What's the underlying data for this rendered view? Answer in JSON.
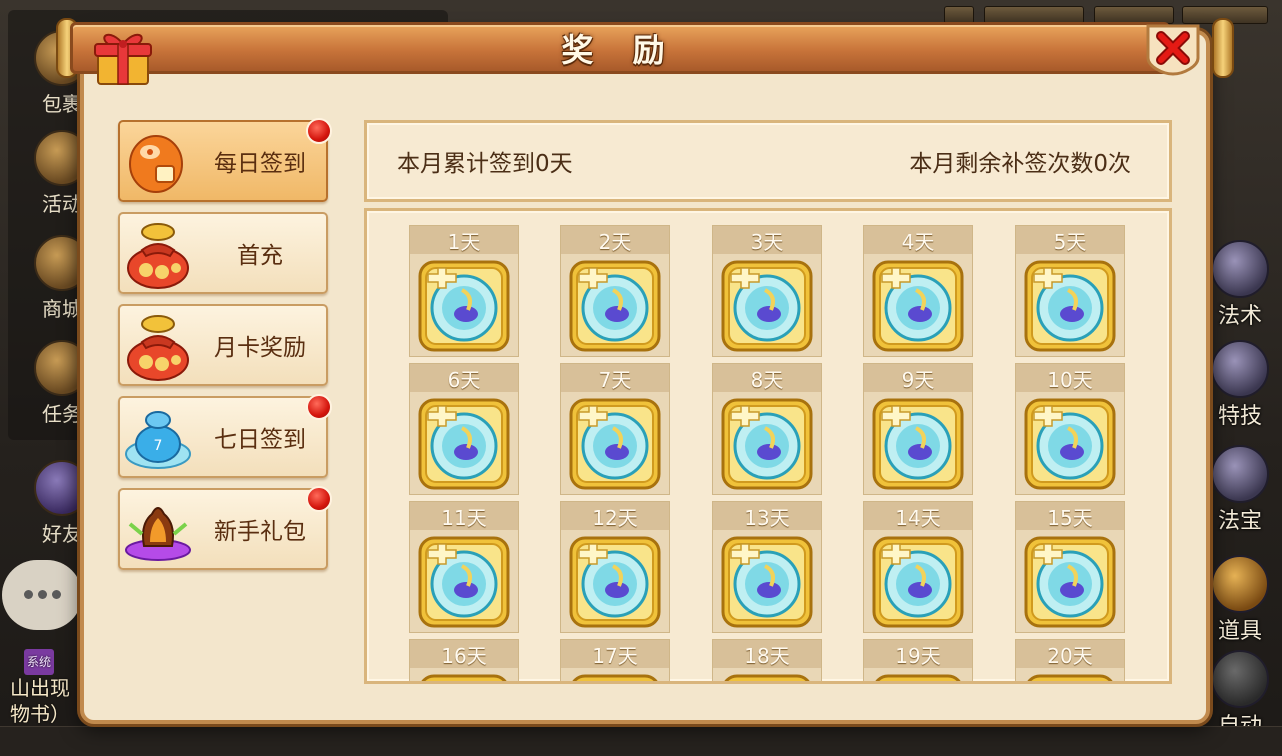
{
  "hud": {
    "left_items": [
      "包裹",
      "活动",
      "商城",
      "任务",
      "好友"
    ],
    "right_items": [
      "法术",
      "特技",
      "法宝",
      "道具",
      "自动"
    ],
    "chat": {
      "tag": "系统",
      "line1": "山出现",
      "line2": "物书）"
    }
  },
  "dialog": {
    "title": "奖 励",
    "tabs": [
      {
        "label": "每日签到",
        "icon": "lantern-icon",
        "badge": true,
        "active": true
      },
      {
        "label": "首充",
        "icon": "money-bag-icon",
        "badge": false,
        "active": false
      },
      {
        "label": "月卡奖励",
        "icon": "money-bag-icon",
        "badge": false,
        "active": false
      },
      {
        "label": "七日签到",
        "icon": "blue-bag-icon",
        "badge": true,
        "active": false
      },
      {
        "label": "新手礼包",
        "icon": "fire-altar-icon",
        "badge": true,
        "active": false
      }
    ],
    "info": {
      "monthly_signed": "本月累计签到0天",
      "makeup_remaining": "本月剩余补签次数0次"
    },
    "days": [
      "1天",
      "2天",
      "3天",
      "4天",
      "5天",
      "6天",
      "7天",
      "8天",
      "9天",
      "10天",
      "11天",
      "12天",
      "13天",
      "14天",
      "15天",
      "16天",
      "17天",
      "18天",
      "19天",
      "20天"
    ]
  },
  "colors": {
    "title_bar": "#c8743a",
    "panel_bg": "#f7ead2",
    "panel_border": "#d9b57c",
    "badge_red": "#d4150d",
    "item_frame": "#f0c23a",
    "item_orb": "#7fd9e6"
  }
}
